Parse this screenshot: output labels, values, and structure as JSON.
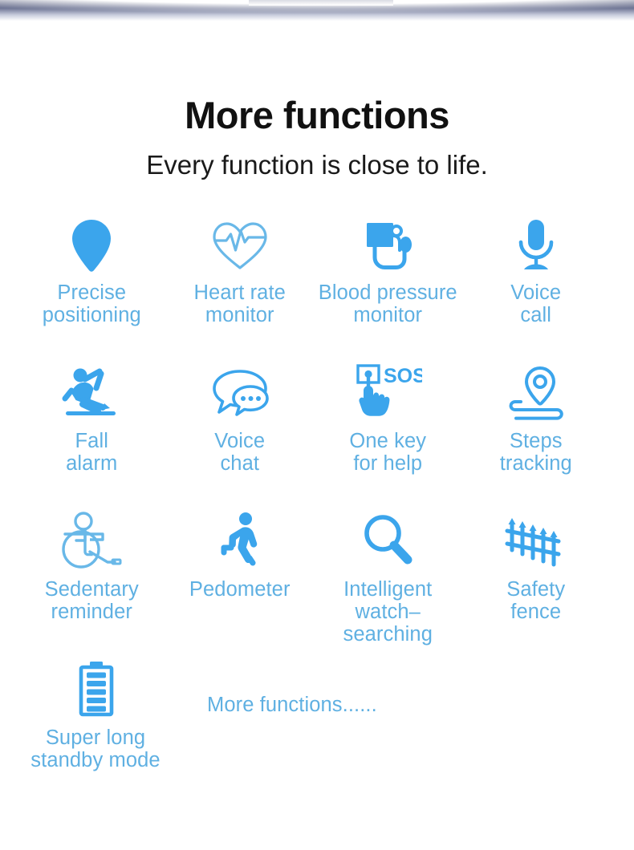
{
  "colors": {
    "icon_blue": "#3ba5ec",
    "icon_blue_light": "#69b8e8",
    "label_blue": "#5fb0e2",
    "heading_black": "#111111",
    "background": "#ffffff",
    "top_band": "#4b5274"
  },
  "header": {
    "title": "More functions",
    "subtitle": "Every function is close to life."
  },
  "features": {
    "rows": [
      [
        {
          "icon": "location-pin-icon",
          "label": "Precise\npositioning"
        },
        {
          "icon": "heart-rate-icon",
          "label": "Heart rate\nmonitor"
        },
        {
          "icon": "blood-pressure-icon",
          "label": "Blood pressure\nmonitor"
        },
        {
          "icon": "microphone-icon",
          "label": "Voice\ncall"
        }
      ],
      [
        {
          "icon": "falling-person-icon",
          "label": "Fall\nalarm"
        },
        {
          "icon": "speech-bubbles-icon",
          "label": "Voice\nchat"
        },
        {
          "icon": "sos-hand-icon",
          "label": "One key\nfor help"
        },
        {
          "icon": "steps-path-pin-icon",
          "label": "Steps\ntracking"
        }
      ],
      [
        {
          "icon": "wheelchair-icon",
          "label": "Sedentary\nreminder"
        },
        {
          "icon": "walking-person-icon",
          "label": "Pedometer"
        },
        {
          "icon": "magnifier-icon",
          "label": "Intelligent\nwatch–searching"
        },
        {
          "icon": "fence-icon",
          "label": "Safety\nfence"
        }
      ]
    ],
    "last_row": {
      "item": {
        "icon": "battery-full-icon",
        "label": "Super long\nstandby mode"
      },
      "more_text": "More functions......"
    },
    "sos_text": "SOS"
  }
}
